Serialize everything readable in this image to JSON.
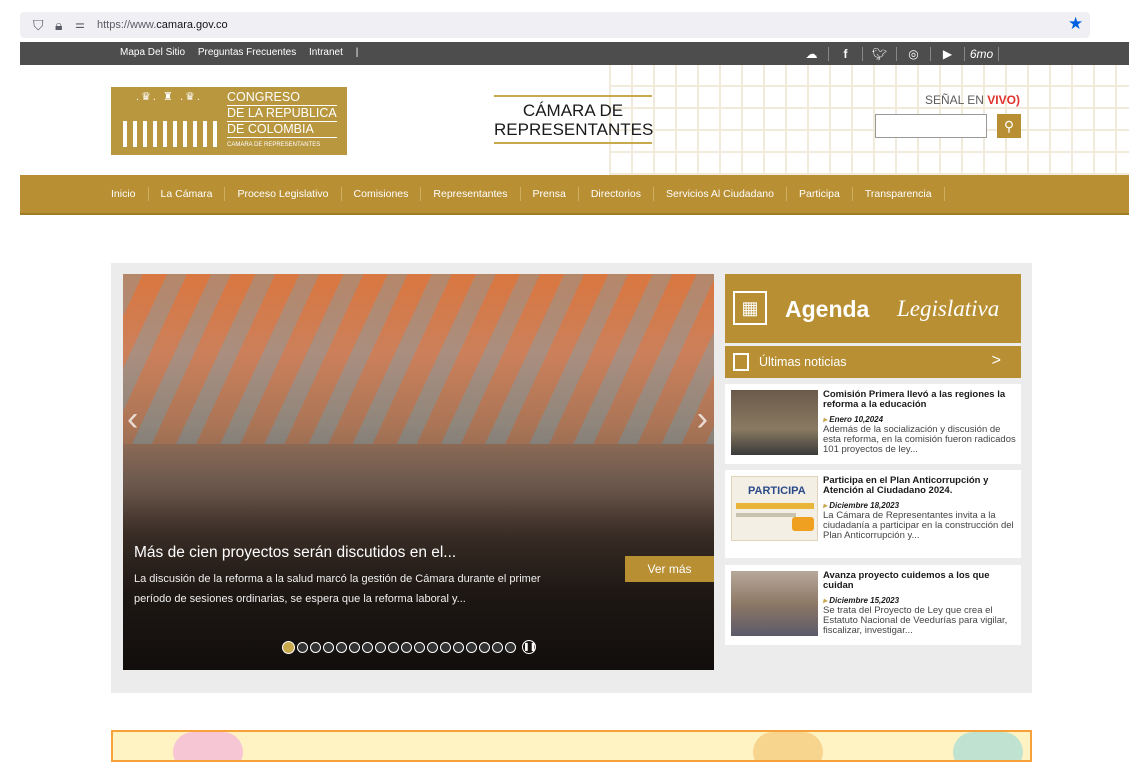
{
  "browser": {
    "url_prefix": "https://www.",
    "url_domain": "camara.gov.co"
  },
  "topbar": {
    "links": [
      "Mapa Del Sitio",
      "Preguntas Frecuentes",
      "Intranet",
      "|"
    ]
  },
  "header": {
    "logo_lines": [
      "CONGRESO",
      "DE LA REPUBLICA",
      "DE COLOMBIA"
    ],
    "logo_small": "CAMARA DE REPRESENTANTES",
    "camara_line1": "CÁMARA DE",
    "camara_line2": "REPRESENTANTES",
    "senal": "SEÑAL EN",
    "senal_live": "VIVO"
  },
  "nav": {
    "items": [
      "Inicio",
      "La Cámara",
      "Proceso Legislativo",
      "Comisiones",
      "Representantes",
      "Prensa",
      "Directorios",
      "Servicios Al Ciudadano",
      "Participa",
      "Transparencia"
    ]
  },
  "slider": {
    "title": "Más de cien proyectos serán discutidos en el...",
    "subtitle": "La discusión de la reforma a la salud marcó la gestión de Cámara durante el primer período de sesiones ordinarias, se espera que la reforma laboral y...",
    "button": "Ver más",
    "slide_count": 18,
    "active_slide": 1
  },
  "sidebar": {
    "agenda_bold": "Agenda",
    "agenda_script": "Legislativa",
    "ultimas": "Últimas noticias",
    "news": [
      {
        "title": "Comisión Primera llevó a las regiones la reforma a la educación",
        "date": "Enero 10,2024",
        "body": "Además de la socialización y discusión de esta reforma, en la comisión fueron radicados 101 proyectos de ley..."
      },
      {
        "title": "Participa en el Plan Anticorrupción y Atención al Ciudadano 2024.",
        "date": "Diciembre 18,2023",
        "body": "La Cámara de Representantes invita a la ciudadanía a participar en la construcción del Plan Anticorrupción y...",
        "thumb_text": "PARTICIPA"
      },
      {
        "title": "Avanza proyecto cuidemos a los que cuidan",
        "date": "Diciembre 15,2023",
        "body": "Se trata del Proyecto de Ley que crea el Estatuto Nacional de Veedurías para vigilar, fiscalizar, investigar..."
      }
    ]
  },
  "colors": {
    "gold": "#b88f33",
    "dark_bar": "#4d4d4d",
    "panel": "#ececec"
  }
}
